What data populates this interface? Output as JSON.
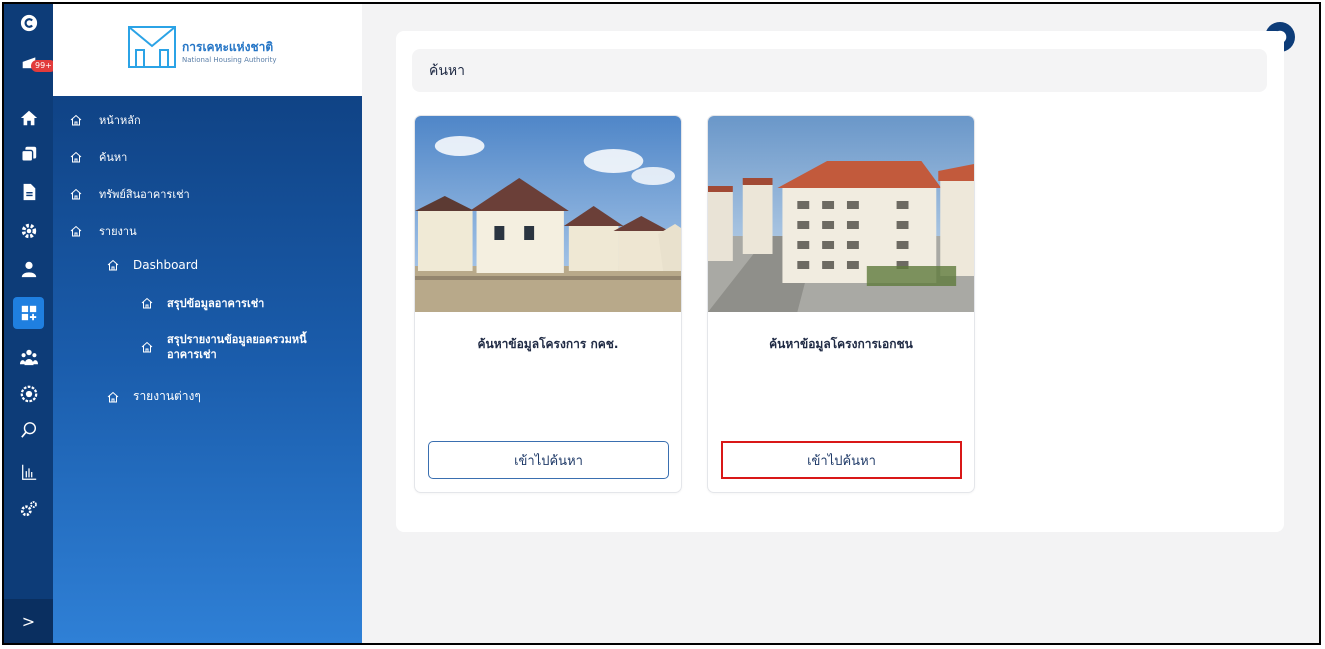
{
  "app": {
    "org_name_th": "การเคหะแห่งชาติ",
    "org_name_en": "National Housing Authority",
    "notification_count": "99+",
    "colors": {
      "primary": "#0d3c78",
      "accent": "#1f7fe0",
      "highlight": "#d91818"
    }
  },
  "rail": {
    "icons": [
      "logo-c-icon",
      "notification-icon",
      "home-icon",
      "copy-icon",
      "document-icon",
      "settings-icon",
      "user-icon",
      "dashboard-icon",
      "group-icon",
      "money-icon",
      "search-icon",
      "chart-icon",
      "gears-icon"
    ],
    "expand_label": ">"
  },
  "sidebar": {
    "items": [
      {
        "label": "หน้าหลัก"
      },
      {
        "label": "ค้นหา"
      },
      {
        "label": "ทรัพย์สินอาคารเช่า"
      },
      {
        "label": "รายงาน"
      }
    ],
    "dashboard": {
      "label": "Dashboard"
    },
    "dashboard_children": [
      {
        "label": "สรุปข้อมูลอาคารเช่า"
      },
      {
        "label_line1": "สรุปรายงานข้อมูลยอดรวมหนี้",
        "label_line2": "อาคารเช่า"
      }
    ],
    "other_reports": {
      "label": "รายงานต่างๆ"
    }
  },
  "main": {
    "search_header": "ค้นหา",
    "cards": [
      {
        "title": "ค้นหาข้อมูลโครงการ กคช.",
        "button": "เข้าไปค้นหา",
        "image_icon": "house-photo"
      },
      {
        "title": "ค้นหาข้อมูลโครงการเอกชน",
        "button": "เข้าไปค้นหา",
        "image_icon": "apartment-photo"
      }
    ]
  }
}
